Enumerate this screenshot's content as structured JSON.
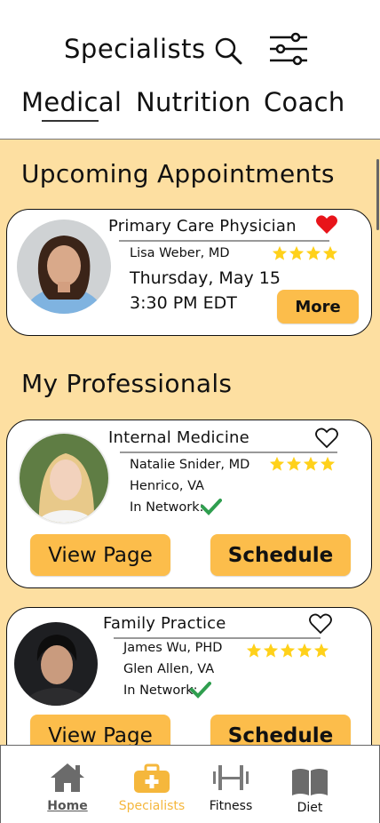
{
  "header": {
    "title": "Specialists",
    "tabs": [
      {
        "label": "Medical",
        "active": true
      },
      {
        "label": "Nutrition",
        "active": false
      },
      {
        "label": "Coach",
        "active": false
      }
    ]
  },
  "sections": {
    "upcoming_title": "Upcoming Appointments",
    "professionals_title": "My Professionals"
  },
  "appointment": {
    "specialty": "Primary Care Physician",
    "doctor": "Lisa Weber, MD",
    "rating": 4,
    "favorited": true,
    "date": "Thursday, May 15",
    "time": "3:30 PM EDT",
    "more_label": "More"
  },
  "professionals": [
    {
      "specialty": "Internal Medicine",
      "doctor": "Natalie Snider, MD",
      "location": "Henrico, VA",
      "network_label": "In Network:",
      "in_network": true,
      "rating": 4,
      "favorited": false,
      "view_label": "View Page",
      "schedule_label": "Schedule"
    },
    {
      "specialty": "Family Practice",
      "doctor": "James Wu, PHD",
      "location": "Glen Allen, VA",
      "network_label": "In Network:",
      "in_network": true,
      "rating": 5,
      "favorited": false,
      "view_label": "View Page",
      "schedule_label": "Schedule"
    }
  ],
  "bottom_nav": [
    {
      "label": "Home",
      "icon": "home-icon"
    },
    {
      "label": "Specialists",
      "icon": "medical-kit-icon",
      "active": true
    },
    {
      "label": "Fitness",
      "icon": "dumbbell-icon"
    },
    {
      "label": "Diet",
      "icon": "book-icon"
    }
  ],
  "colors": {
    "accent": "#fcbd4b",
    "background": "#fddfa1",
    "star": "#ffd11a",
    "heart": "#e8141a",
    "check": "#2f9e4f",
    "nav_active": "#f5b73c"
  }
}
